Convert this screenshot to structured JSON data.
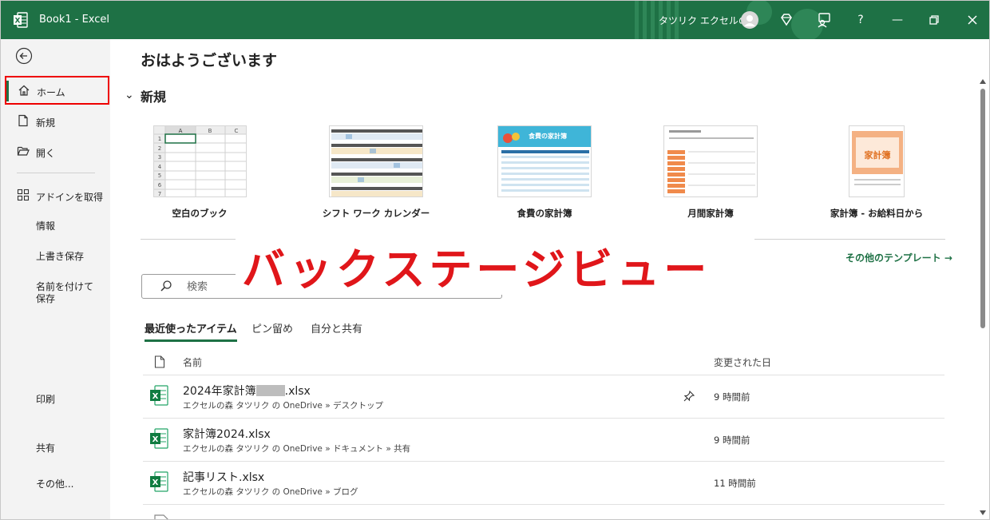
{
  "window": {
    "app_title": "Book1  -  Excel",
    "user_name": "タツリク エクセルの森"
  },
  "sidebar": {
    "items": [
      {
        "label": "ホーム",
        "icon": "home-icon"
      },
      {
        "label": "新規",
        "icon": "new-file-icon"
      },
      {
        "label": "開く",
        "icon": "open-folder-icon"
      },
      {
        "label": "アドインを取得",
        "icon": "addins-icon"
      },
      {
        "label": "情報"
      },
      {
        "label": "上書き保存"
      },
      {
        "label": "名前を付けて保存"
      },
      {
        "label": "印刷"
      },
      {
        "label": "共有"
      },
      {
        "label": "その他..."
      }
    ]
  },
  "main": {
    "greeting": "おはようございます",
    "new_section_title": "新規",
    "templates": [
      {
        "name": "空白のブック",
        "grid_cols": [
          "A",
          "B",
          "C"
        ],
        "grid_rows": [
          "1",
          "2",
          "3",
          "4",
          "5",
          "6",
          "7"
        ]
      },
      {
        "name": "シフト ワーク カレンダー"
      },
      {
        "name": "食費の家計簿",
        "thumb_title": "食費の家計簿"
      },
      {
        "name": "月間家計簿"
      },
      {
        "name": "家計簿 - お給料日から",
        "thumb_title": "家計簿"
      }
    ],
    "more_templates": "その他のテンプレート →",
    "search_placeholder": "検索",
    "overlay_caption": "バックステージビュー",
    "tabs": [
      "最近使ったアイテム",
      "ピン留め",
      "自分と共有"
    ],
    "columns": {
      "name": "名前",
      "modified": "変更された日"
    },
    "files": [
      {
        "name_prefix": "2024年家計簿",
        "name_suffix": ".xlsx",
        "path": "エクセルの森 タツリク の OneDrive » デスクトップ",
        "modified": "9 時間前",
        "pinned": true
      },
      {
        "name": "家計簿2024.xlsx",
        "path": "エクセルの森 タツリク の OneDrive » ドキュメント » 共有",
        "modified": "9 時間前"
      },
      {
        "name": "記事リスト.xlsx",
        "path": "エクセルの森 タツリク の OneDrive » ブログ",
        "modified": "11 時間前"
      }
    ]
  },
  "colors": {
    "excel_green": "#1e7145",
    "highlight_red": "#e00000",
    "overlay_text": "#e0161a"
  }
}
